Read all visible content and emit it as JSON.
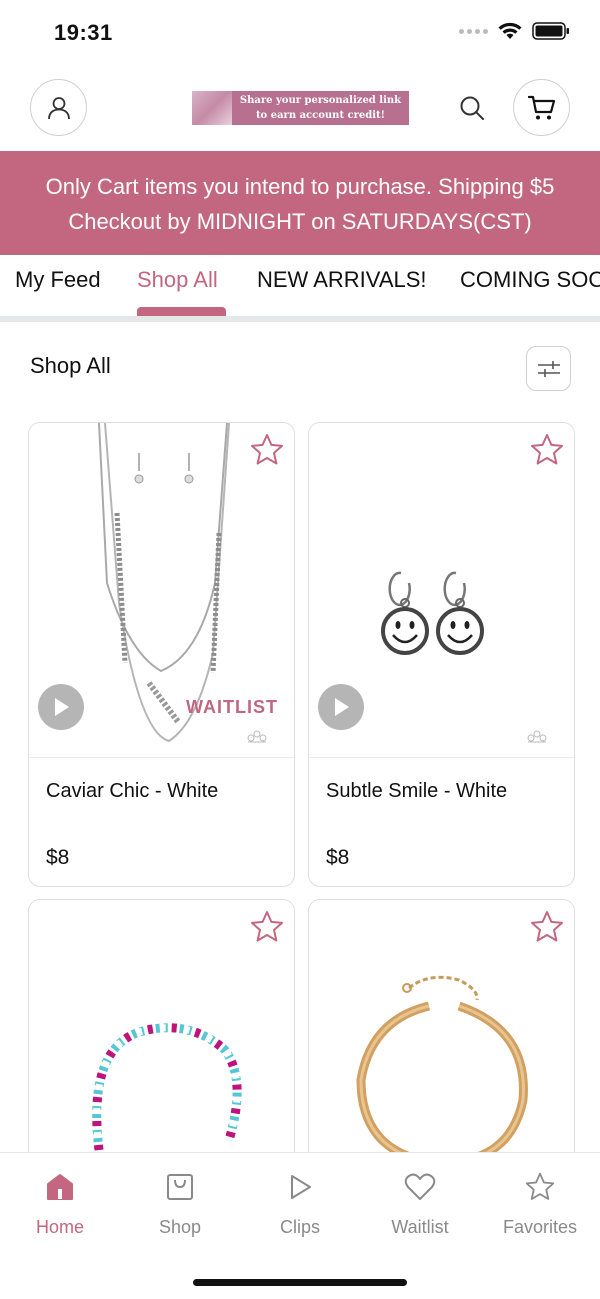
{
  "status_bar": {
    "time": "19:31"
  },
  "header": {
    "banner_line1": "Share your personalized link",
    "banner_line2": "to earn account credit!"
  },
  "announcement": {
    "line1": "Only Cart items you intend to purchase. Shipping $5",
    "line2": "Checkout by MIDNIGHT on SATURDAYS(CST)"
  },
  "tabs": [
    {
      "label": "My Feed",
      "active": false
    },
    {
      "label": "Shop All",
      "active": true
    },
    {
      "label": "NEW ARRIVALS!",
      "active": false
    },
    {
      "label": "COMING SOON",
      "active": false
    }
  ],
  "section": {
    "title": "Shop All"
  },
  "products": [
    {
      "name": "Caviar Chic - White",
      "price": "$8",
      "badge": "WAITLIST",
      "has_video": true
    },
    {
      "name": "Subtle Smile - White",
      "price": "$8",
      "badge": "",
      "has_video": true
    },
    {
      "name": "",
      "price": "",
      "badge": "",
      "has_video": false
    },
    {
      "name": "",
      "price": "",
      "badge": "",
      "has_video": false
    }
  ],
  "bottom_nav": [
    {
      "label": "Home",
      "icon": "home-icon",
      "active": true
    },
    {
      "label": "Shop",
      "icon": "shopping-bag-icon",
      "active": false
    },
    {
      "label": "Clips",
      "icon": "play-icon",
      "active": false
    },
    {
      "label": "Waitlist",
      "icon": "heart-icon",
      "active": false
    },
    {
      "label": "Favorites",
      "icon": "star-icon",
      "active": false
    }
  ],
  "colors": {
    "accent": "#c2677f",
    "divider": "#e4e8e8",
    "muted": "#8a8a8a"
  }
}
